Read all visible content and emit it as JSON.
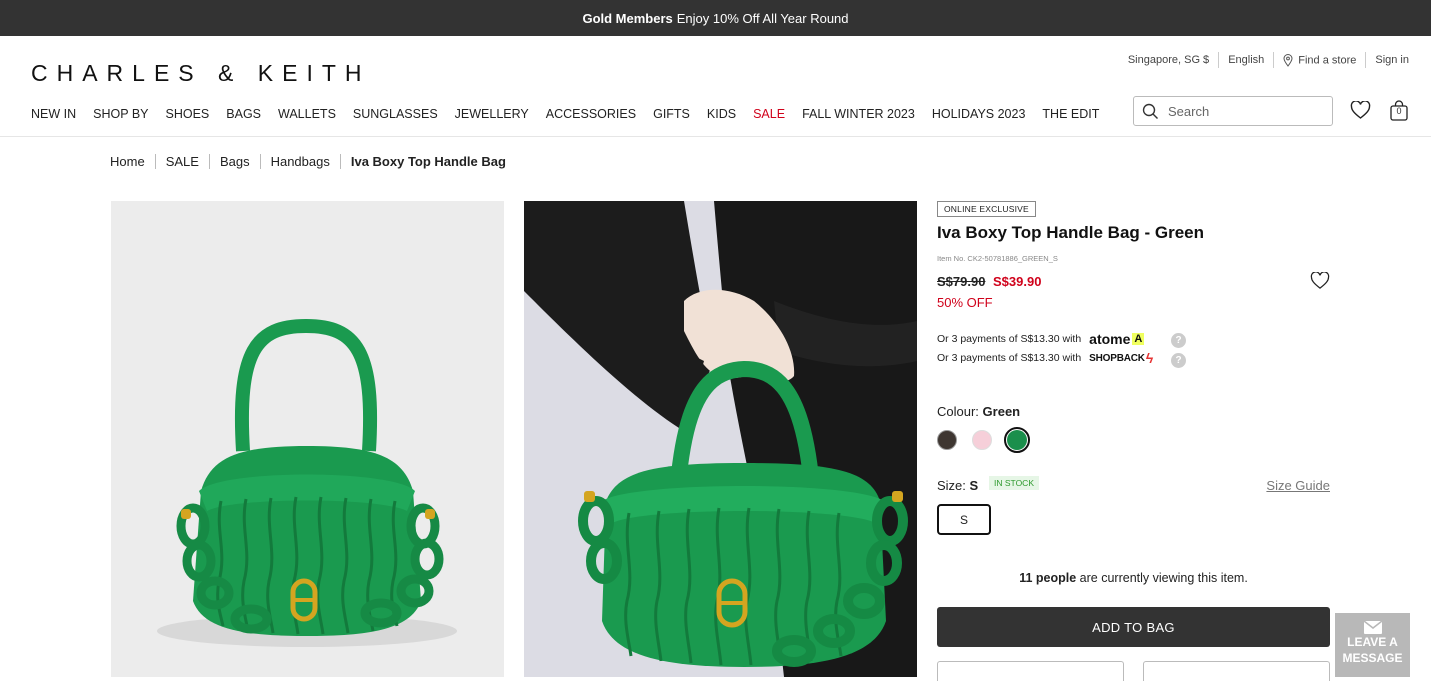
{
  "promo": {
    "bold": "Gold Members",
    "text": "Enjoy 10% Off All Year Round"
  },
  "header": {
    "logo": "CHARLES & KEITH",
    "region": "Singapore, SG $",
    "language": "English",
    "find_store": "Find a store",
    "sign_in": "Sign in",
    "search_placeholder": "Search",
    "bag_count": "0"
  },
  "nav": [
    "NEW IN",
    "SHOP BY",
    "SHOES",
    "BAGS",
    "WALLETS",
    "SUNGLASSES",
    "JEWELLERY",
    "ACCESSORIES",
    "GIFTS",
    "KIDS",
    "SALE",
    "FALL WINTER 2023",
    "HOLIDAYS 2023",
    "THE EDIT"
  ],
  "breadcrumb": [
    "Home",
    "SALE",
    "Bags",
    "Handbags",
    "Iva Boxy Top Handle Bag"
  ],
  "product": {
    "badge": "ONLINE EXCLUSIVE",
    "title": "Iva Boxy Top Handle Bag - Green",
    "item_no": "Item No. CK2-50781886_GREEN_S",
    "old_price": "S$79.90",
    "new_price": "S$39.90",
    "discount": "50% OFF",
    "pay1_text": "Or 3 payments of S$13.30 with",
    "pay1_brand": "atome",
    "pay2_text": "Or 3 payments of S$13.30 with",
    "pay2_brand": "SHOPBACK",
    "colour_label": "Colour:",
    "colour_value": "Green",
    "swatches": [
      "#3e3631",
      "#f6cfd9",
      "#1a8f4c"
    ],
    "size_label": "Size:",
    "size_value": "S",
    "stock": "IN STOCK",
    "size_guide": "Size Guide",
    "size_option": "S",
    "viewing_count": "11 people",
    "viewing_text": "are currently viewing this item.",
    "add_to_bag": "ADD TO BAG"
  },
  "chat": {
    "line1": "LEAVE A",
    "line2": "MESSAGE"
  },
  "colors": {
    "sale_red": "#d0021b",
    "dark": "#333333",
    "bag_green": "#1a9a4f"
  }
}
